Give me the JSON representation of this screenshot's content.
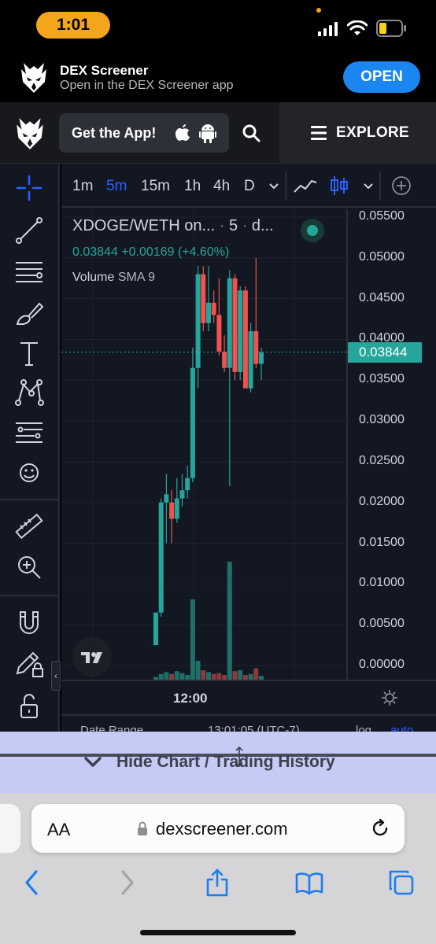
{
  "status_bar": {
    "time": "1:01"
  },
  "app_banner": {
    "title": "DEX Screener",
    "subtitle": "Open in the DEX Screener app",
    "open_label": "OPEN"
  },
  "header": {
    "get_app_label": "Get the App!",
    "explore_label": "EXPLORE"
  },
  "timeframes": [
    "1m",
    "5m",
    "15m",
    "1h",
    "4h",
    "D"
  ],
  "active_timeframe": "5m",
  "chart": {
    "pair_title": "XDOGE/WETH on...",
    "interval_label": "5",
    "source_label": "d...",
    "legend_price": "0.03844 +0.00169 (+4.60%)",
    "volume_label": "Volume",
    "volume_sma": "SMA 9",
    "current_price_tag": "0.03844",
    "time_label": "12:00",
    "bottom_text_left": "Date Range",
    "bottom_text_mid": "13:01:05 (UTC-7)",
    "bottom_text_right": "log",
    "bottom_text_auto": "auto"
  },
  "chart_data": {
    "type": "candlestick",
    "price_axis_ticks": [
      "0.05500",
      "0.05000",
      "0.04500",
      "0.04000",
      "0.03500",
      "0.03000",
      "0.02500",
      "0.02000",
      "0.01500",
      "0.01000",
      "0.00500",
      "0.00000"
    ],
    "ylim": [
      0,
      0.055
    ],
    "last_price": 0.03844,
    "x_tick": "12:00",
    "colors": {
      "up": "#26a69a",
      "down": "#ef5350"
    },
    "candles": [
      {
        "o": 0.0025,
        "h": 0.0065,
        "l": 0.0025,
        "c": 0.0065
      },
      {
        "o": 0.0065,
        "h": 0.0205,
        "l": 0.006,
        "c": 0.02
      },
      {
        "o": 0.02,
        "h": 0.0235,
        "l": 0.015,
        "c": 0.021
      },
      {
        "o": 0.02,
        "h": 0.0215,
        "l": 0.015,
        "c": 0.018
      },
      {
        "o": 0.018,
        "h": 0.023,
        "l": 0.0175,
        "c": 0.0205
      },
      {
        "o": 0.0205,
        "h": 0.0235,
        "l": 0.0195,
        "c": 0.0215
      },
      {
        "o": 0.0215,
        "h": 0.0245,
        "l": 0.0205,
        "c": 0.023
      },
      {
        "o": 0.023,
        "h": 0.039,
        "l": 0.0225,
        "c": 0.0365
      },
      {
        "o": 0.0365,
        "h": 0.049,
        "l": 0.034,
        "c": 0.048
      },
      {
        "o": 0.048,
        "h": 0.049,
        "l": 0.041,
        "c": 0.042
      },
      {
        "o": 0.042,
        "h": 0.049,
        "l": 0.041,
        "c": 0.0445
      },
      {
        "o": 0.0445,
        "h": 0.046,
        "l": 0.042,
        "c": 0.043
      },
      {
        "o": 0.043,
        "h": 0.0475,
        "l": 0.038,
        "c": 0.0385
      },
      {
        "o": 0.0385,
        "h": 0.0405,
        "l": 0.036,
        "c": 0.0365
      },
      {
        "o": 0.0365,
        "h": 0.0485,
        "l": 0.022,
        "c": 0.0475
      },
      {
        "o": 0.0475,
        "h": 0.048,
        "l": 0.035,
        "c": 0.036
      },
      {
        "o": 0.036,
        "h": 0.0465,
        "l": 0.035,
        "c": 0.046
      },
      {
        "o": 0.046,
        "h": 0.0465,
        "l": 0.034,
        "c": 0.034
      },
      {
        "o": 0.034,
        "h": 0.042,
        "l": 0.0335,
        "c": 0.041
      },
      {
        "o": 0.041,
        "h": 0.05,
        "l": 0.0365,
        "c": 0.037
      },
      {
        "o": 0.037,
        "h": 0.039,
        "l": 0.035,
        "c": 0.0384
      }
    ],
    "volumes": [
      0.3,
      0.6,
      0.8,
      0.6,
      0.9,
      0.7,
      0.5,
      8.5,
      2.0,
      1.0,
      0.8,
      0.6,
      0.7,
      0.5,
      12.5,
      0.9,
      1.0,
      0.5,
      0.6,
      1.2,
      0.4
    ]
  },
  "hide_chart": {
    "label": "Hide Chart / Trading History"
  },
  "safari": {
    "aa_label": "AA",
    "url": "dexscreener.com"
  }
}
